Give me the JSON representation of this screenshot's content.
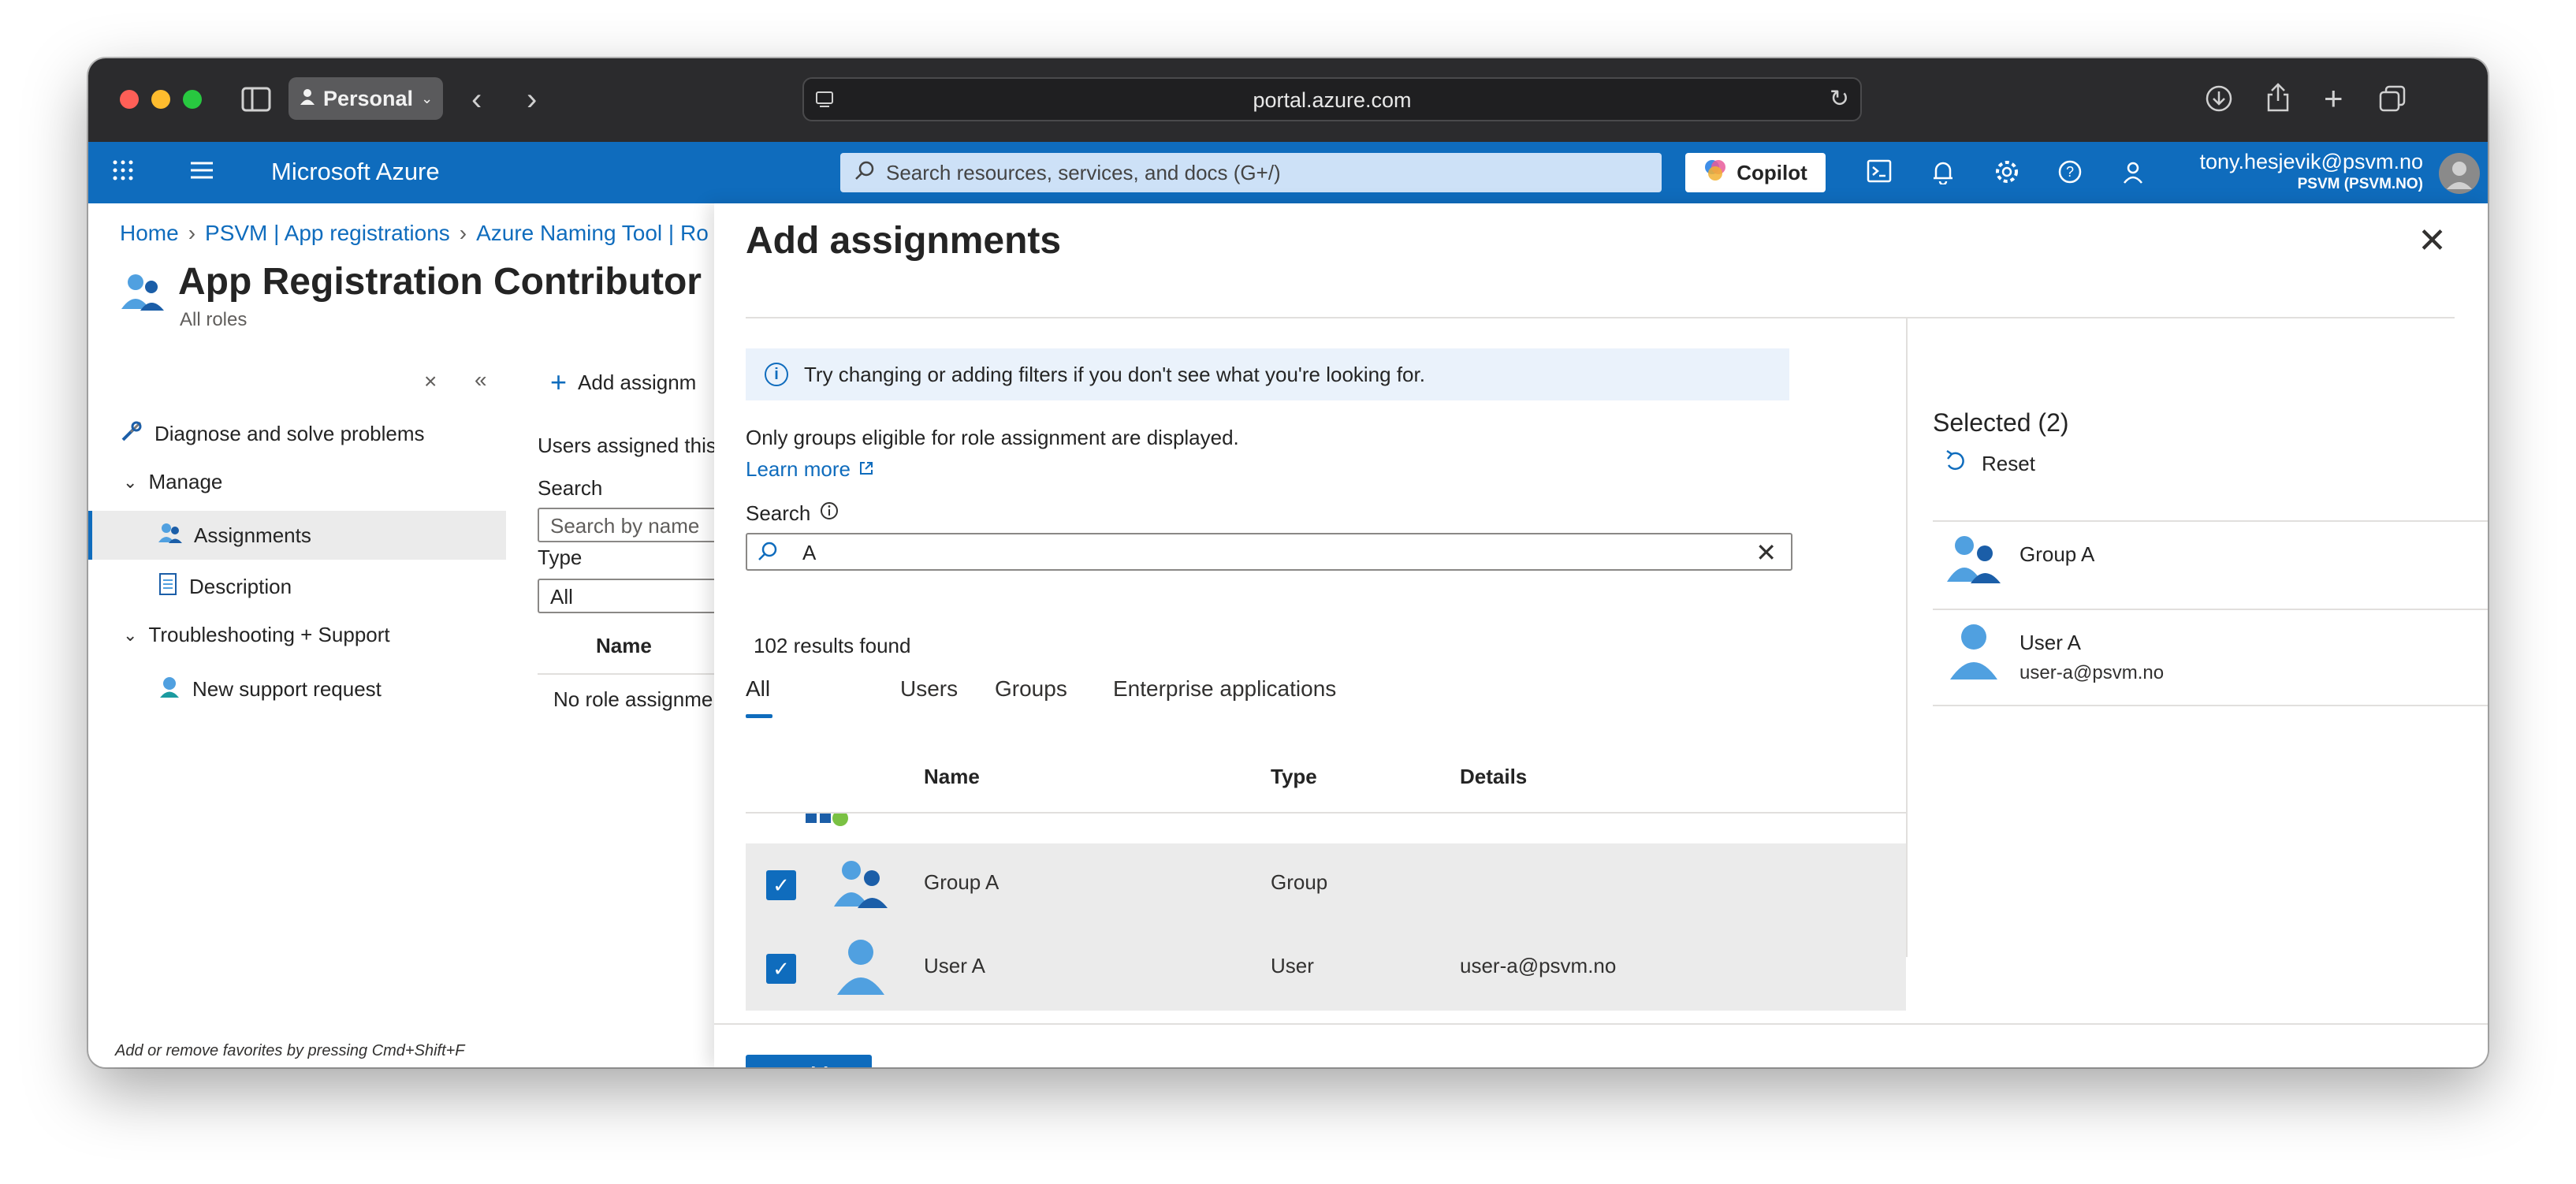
{
  "browser": {
    "profile": "Personal",
    "url": "portal.azure.com"
  },
  "azure": {
    "brand": "Microsoft Azure",
    "search_placeholder": "Search resources, services, and docs (G+/)",
    "copilot": "Copilot",
    "account_email": "tony.hesjevik@psvm.no",
    "account_tenant": "PSVM (PSVM.NO)"
  },
  "breadcrumb": [
    "Home",
    "PSVM | App registrations",
    "Azure Naming Tool | Ro"
  ],
  "page": {
    "title": "App Registration Contributor | A",
    "subtitle": "All roles"
  },
  "leftnav": {
    "diagnose": "Diagnose and solve problems",
    "manage": "Manage",
    "assignments": "Assignments",
    "description": "Description",
    "troubleshooting": "Troubleshooting + Support",
    "new_support": "New support request",
    "footer_hint": "Add or remove favorites by pressing Cmd+Shift+F"
  },
  "main": {
    "add_assignments": "Add assignm",
    "users_assigned": "Users assigned this",
    "search_label": "Search",
    "search_placeholder": "Search by name",
    "type_label": "Type",
    "type_value": "All",
    "name_header": "Name",
    "no_role": "No role assignmen"
  },
  "blade": {
    "title": "Add assignments",
    "info": "Try changing or adding filters if you don't see what you're looking for.",
    "eligible_note": "Only groups eligible for role assignment are displayed.",
    "learn_more": "Learn more",
    "search_label": "Search",
    "search_value": "A",
    "results": "102 results found",
    "tabs": [
      "All",
      "Users",
      "Groups",
      "Enterprise applications"
    ],
    "columns": [
      "Name",
      "Type",
      "Details"
    ],
    "rows": [
      {
        "name": "Group A",
        "type": "Group",
        "details": ""
      },
      {
        "name": "User A",
        "type": "User",
        "details": "user-a@psvm.no"
      }
    ],
    "add_button": "Add"
  },
  "selected": {
    "title": "Selected (2)",
    "reset": "Reset",
    "items": [
      {
        "name": "Group A",
        "sub": ""
      },
      {
        "name": "User A",
        "sub": "user-a@psvm.no"
      }
    ]
  },
  "colors": {
    "azure_blue": "#0f6cbd",
    "chrome_dark": "#2b2b2d",
    "row_selected": "#ebebeb"
  }
}
